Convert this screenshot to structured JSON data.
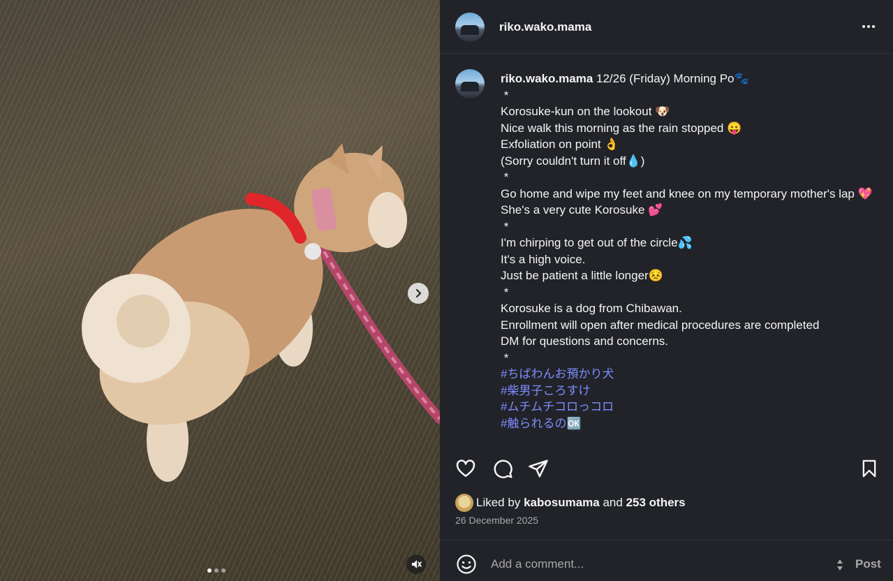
{
  "post": {
    "username": "riko.wako.mama",
    "carousel": {
      "slide_count": 3,
      "active_slide": 1
    }
  },
  "caption": {
    "author": "riko.wako.mama",
    "lines": [
      "12/26 (Friday) Morning Po🐾",
      " *",
      "Korosuke-kun on the lookout 🐶",
      "Nice walk this morning as the rain stopped 😛",
      "Exfoliation on point 👌",
      "(Sorry couldn't turn it off💧)",
      " *",
      "Go home and wipe my feet and knee on my temporary mother's lap 💖",
      "She's a very cute Korosuke 💕",
      " *",
      "I'm chirping to get out of the circle💦",
      "It's a high voice.",
      "Just be patient a little longer😣",
      " *",
      "Korosuke is a dog from Chibawan.",
      "Enrollment will open after medical procedures are completed",
      "DM for questions and concerns.",
      " *"
    ],
    "hashtags": [
      "#ちばわんお預かり犬",
      "#柴男子ころすけ",
      "#ムチムチコロっコロ",
      "#触られるの🆗"
    ]
  },
  "actions": {
    "icons": [
      "heart-icon",
      "comment-icon",
      "share-icon",
      "bookmark-icon"
    ]
  },
  "likes": {
    "prefix": "Liked by",
    "first_liker": "kabosumama",
    "joiner": "and",
    "others": "253 others"
  },
  "date": "26 December 2025",
  "comment": {
    "placeholder": "Add a comment...",
    "post_label": "Post"
  },
  "colors": {
    "panel_bg": "#212328",
    "hashtag": "#7e8cff",
    "muted_text": "#a8a8a8"
  }
}
